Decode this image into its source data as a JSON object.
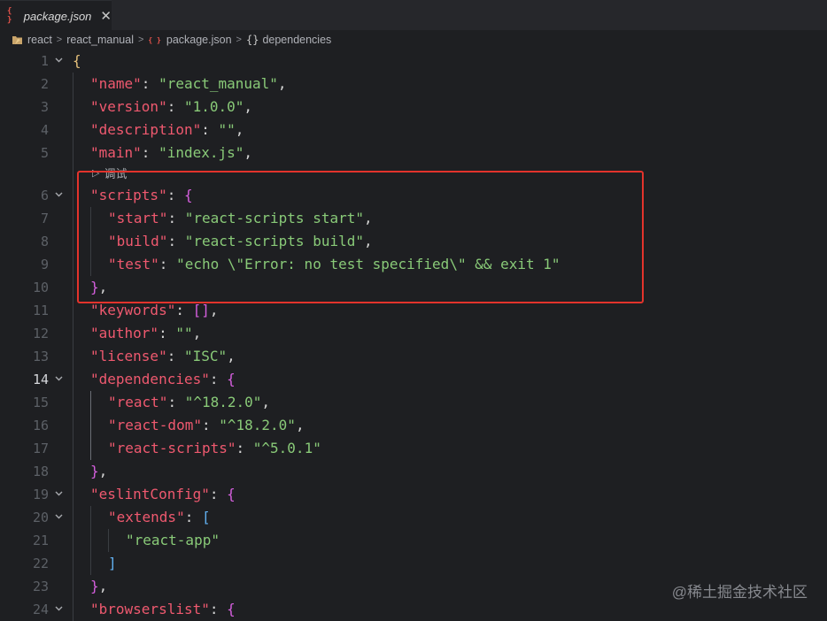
{
  "tab": {
    "label": "package.json",
    "icon": "json-file-icon",
    "close_glyph": "✕"
  },
  "breadcrumb": [
    {
      "label": "react",
      "icon": "folder-icon"
    },
    {
      "label": "react_manual",
      "icon": ""
    },
    {
      "label": "package.json",
      "icon": "json-file-icon"
    },
    {
      "label": "dependencies",
      "icon": "braces-icon"
    }
  ],
  "codelens": {
    "label": "调试",
    "icon": "play-icon"
  },
  "editor": {
    "active_line": 14,
    "lines": [
      {
        "n": 1,
        "indent": 0,
        "fold": true,
        "tokens": [
          {
            "t": "{",
            "c": "b1"
          }
        ]
      },
      {
        "n": 2,
        "indent": 1,
        "fold": false,
        "tokens": [
          {
            "t": "\"name\"",
            "c": "k"
          },
          {
            "t": ": ",
            "c": "p"
          },
          {
            "t": "\"react_manual\"",
            "c": "s"
          },
          {
            "t": ",",
            "c": "p"
          }
        ]
      },
      {
        "n": 3,
        "indent": 1,
        "fold": false,
        "tokens": [
          {
            "t": "\"version\"",
            "c": "k"
          },
          {
            "t": ": ",
            "c": "p"
          },
          {
            "t": "\"1.0.0\"",
            "c": "s"
          },
          {
            "t": ",",
            "c": "p"
          }
        ]
      },
      {
        "n": 4,
        "indent": 1,
        "fold": false,
        "tokens": [
          {
            "t": "\"description\"",
            "c": "k"
          },
          {
            "t": ": ",
            "c": "p"
          },
          {
            "t": "\"\"",
            "c": "s"
          },
          {
            "t": ",",
            "c": "p"
          }
        ]
      },
      {
        "n": 5,
        "indent": 1,
        "fold": false,
        "tokens": [
          {
            "t": "\"main\"",
            "c": "k"
          },
          {
            "t": ": ",
            "c": "p"
          },
          {
            "t": "\"index.js\"",
            "c": "s"
          },
          {
            "t": ",",
            "c": "p"
          }
        ]
      },
      {
        "n": 6,
        "indent": 1,
        "fold": true,
        "tokens": [
          {
            "t": "\"scripts\"",
            "c": "k"
          },
          {
            "t": ": ",
            "c": "p"
          },
          {
            "t": "{",
            "c": "b2"
          }
        ]
      },
      {
        "n": 7,
        "indent": 2,
        "fold": false,
        "tokens": [
          {
            "t": "\"start\"",
            "c": "k"
          },
          {
            "t": ": ",
            "c": "p"
          },
          {
            "t": "\"react-scripts start\"",
            "c": "s"
          },
          {
            "t": ",",
            "c": "p"
          }
        ]
      },
      {
        "n": 8,
        "indent": 2,
        "fold": false,
        "tokens": [
          {
            "t": "\"build\"",
            "c": "k"
          },
          {
            "t": ": ",
            "c": "p"
          },
          {
            "t": "\"react-scripts build\"",
            "c": "s"
          },
          {
            "t": ",",
            "c": "p"
          }
        ]
      },
      {
        "n": 9,
        "indent": 2,
        "fold": false,
        "tokens": [
          {
            "t": "\"test\"",
            "c": "k"
          },
          {
            "t": ": ",
            "c": "p"
          },
          {
            "t": "\"echo \\\"Error: no test specified\\\" && exit 1\"",
            "c": "s"
          }
        ]
      },
      {
        "n": 10,
        "indent": 1,
        "fold": false,
        "tokens": [
          {
            "t": "}",
            "c": "b2"
          },
          {
            "t": ",",
            "c": "p"
          }
        ]
      },
      {
        "n": 11,
        "indent": 1,
        "fold": false,
        "tokens": [
          {
            "t": "\"keywords\"",
            "c": "k"
          },
          {
            "t": ": ",
            "c": "p"
          },
          {
            "t": "[]",
            "c": "b2"
          },
          {
            "t": ",",
            "c": "p"
          }
        ]
      },
      {
        "n": 12,
        "indent": 1,
        "fold": false,
        "tokens": [
          {
            "t": "\"author\"",
            "c": "k"
          },
          {
            "t": ": ",
            "c": "p"
          },
          {
            "t": "\"\"",
            "c": "s"
          },
          {
            "t": ",",
            "c": "p"
          }
        ]
      },
      {
        "n": 13,
        "indent": 1,
        "fold": false,
        "tokens": [
          {
            "t": "\"license\"",
            "c": "k"
          },
          {
            "t": ": ",
            "c": "p"
          },
          {
            "t": "\"ISC\"",
            "c": "s"
          },
          {
            "t": ",",
            "c": "p"
          }
        ]
      },
      {
        "n": 14,
        "indent": 1,
        "fold": true,
        "tokens": [
          {
            "t": "\"dependencies\"",
            "c": "k"
          },
          {
            "t": ": ",
            "c": "p"
          },
          {
            "t": "{",
            "c": "b2"
          }
        ]
      },
      {
        "n": 15,
        "indent": 2,
        "fold": false,
        "tokens": [
          {
            "t": "\"react\"",
            "c": "k"
          },
          {
            "t": ": ",
            "c": "p"
          },
          {
            "t": "\"^18.2.0\"",
            "c": "s"
          },
          {
            "t": ",",
            "c": "p"
          }
        ]
      },
      {
        "n": 16,
        "indent": 2,
        "fold": false,
        "tokens": [
          {
            "t": "\"react-dom\"",
            "c": "k"
          },
          {
            "t": ": ",
            "c": "p"
          },
          {
            "t": "\"^18.2.0\"",
            "c": "s"
          },
          {
            "t": ",",
            "c": "p"
          }
        ]
      },
      {
        "n": 17,
        "indent": 2,
        "fold": false,
        "tokens": [
          {
            "t": "\"react-scripts\"",
            "c": "k"
          },
          {
            "t": ": ",
            "c": "p"
          },
          {
            "t": "\"^5.0.1\"",
            "c": "s"
          }
        ]
      },
      {
        "n": 18,
        "indent": 1,
        "fold": false,
        "tokens": [
          {
            "t": "}",
            "c": "b2"
          },
          {
            "t": ",",
            "c": "p"
          }
        ]
      },
      {
        "n": 19,
        "indent": 1,
        "fold": true,
        "tokens": [
          {
            "t": "\"eslintConfig\"",
            "c": "k"
          },
          {
            "t": ": ",
            "c": "p"
          },
          {
            "t": "{",
            "c": "b2"
          }
        ]
      },
      {
        "n": 20,
        "indent": 2,
        "fold": true,
        "tokens": [
          {
            "t": "\"extends\"",
            "c": "k"
          },
          {
            "t": ": ",
            "c": "p"
          },
          {
            "t": "[",
            "c": "b3"
          }
        ]
      },
      {
        "n": 21,
        "indent": 3,
        "fold": false,
        "tokens": [
          {
            "t": "\"react-app\"",
            "c": "s"
          }
        ]
      },
      {
        "n": 22,
        "indent": 2,
        "fold": false,
        "tokens": [
          {
            "t": "]",
            "c": "b3"
          }
        ]
      },
      {
        "n": 23,
        "indent": 1,
        "fold": false,
        "tokens": [
          {
            "t": "}",
            "c": "b2"
          },
          {
            "t": ",",
            "c": "p"
          }
        ]
      },
      {
        "n": 24,
        "indent": 1,
        "fold": true,
        "tokens": [
          {
            "t": "\"browserslist\"",
            "c": "k"
          },
          {
            "t": ": ",
            "c": "p"
          },
          {
            "t": "{",
            "c": "b2"
          }
        ]
      }
    ]
  },
  "annotation": {
    "highlight_color": "#e3332c"
  },
  "watermark": "@稀土掘金技术社区",
  "colors": {
    "background": "#1e1f22",
    "key": "#ef596f",
    "string": "#89ca78",
    "bracket_level1": "#e5c07b",
    "bracket_level2": "#d55fde",
    "bracket_level3": "#61afef"
  }
}
